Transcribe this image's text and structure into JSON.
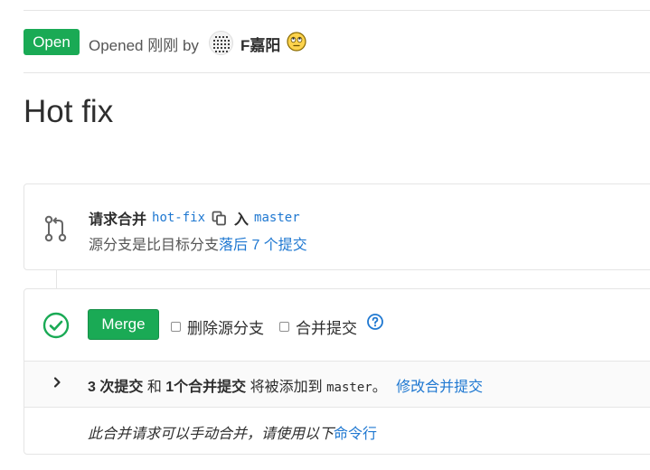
{
  "header": {
    "status": "Open",
    "opened_text": "Opened 刚刚 by",
    "author": "F嘉阳",
    "author_emoji_icon": "rolling-eyes-emoji-icon"
  },
  "title": "Hot fix",
  "merge_info": {
    "icon": "merge-request-icon",
    "prefix": "请求合并",
    "source_branch": "hot-fix",
    "copy_icon": "copy-icon",
    "into": "入",
    "target_branch": "master",
    "behind_prefix": "源分支是比目标分支",
    "behind_link": "落后 7 个提交"
  },
  "merge_widget": {
    "status_icon": "check-circle-icon",
    "merge_button": "Merge",
    "delete_source_label": "删除源分支",
    "squash_label": "合并提交",
    "help_icon": "question-circle-icon",
    "commits": {
      "commit_count": "3 次提交",
      "and": "和",
      "merge_commit": "1个合并提交",
      "will_add": "将被添加到",
      "target": "master",
      "period": "。",
      "modify_link": "修改合并提交"
    },
    "manual_text": "此合并请求可以手动合并，请使用以下",
    "cmd_link": "命令行"
  },
  "colors": {
    "success_green": "#1aaa55",
    "link_blue": "#1f78d1",
    "border": "#e5e5e5"
  }
}
